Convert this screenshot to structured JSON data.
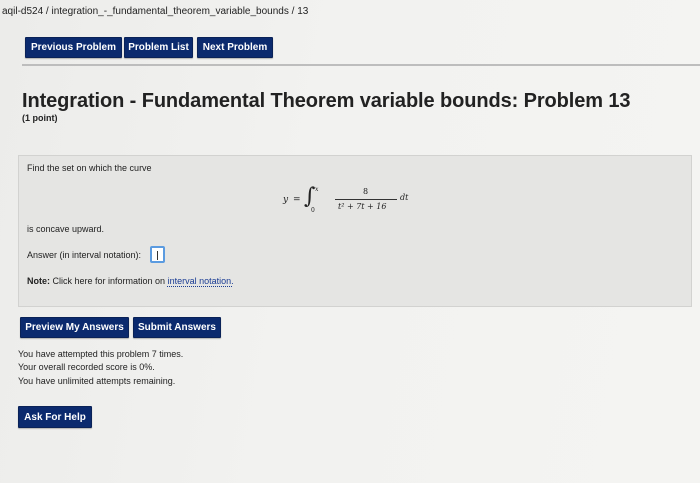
{
  "breadcrumb": "aqil-d524 / integration_-_fundamental_theorem_variable_bounds / 13",
  "nav": {
    "previous": "Previous Problem",
    "list": "Problem List",
    "next": "Next Problem"
  },
  "problem": {
    "title": "Integration - Fundamental Theorem variable bounds: Problem 13",
    "points": "(1 point)",
    "prompt": "Find the set on which the curve",
    "formula": {
      "lhs": "y",
      "equals": "=",
      "upper": "x",
      "lower": "0",
      "numerator": "8",
      "denominator": "t² + 7t + 16",
      "differential": "dt"
    },
    "condition": "is concave upward.",
    "answer_label": "Answer (in interval notation):",
    "answer_value": "",
    "note_label": "Note:",
    "note_text": "Click here for information on",
    "note_link": "interval notation."
  },
  "actions": {
    "preview": "Preview My Answers",
    "submit": "Submit Answers"
  },
  "status": {
    "attempts": "You have attempted this problem 7 times.",
    "score": "Your overall recorded score is 0%.",
    "remaining": "You have unlimited attempts remaining."
  },
  "help": "Ask For Help",
  "colors": {
    "button": "#0b2a6e",
    "focus": "#5b9be0"
  }
}
